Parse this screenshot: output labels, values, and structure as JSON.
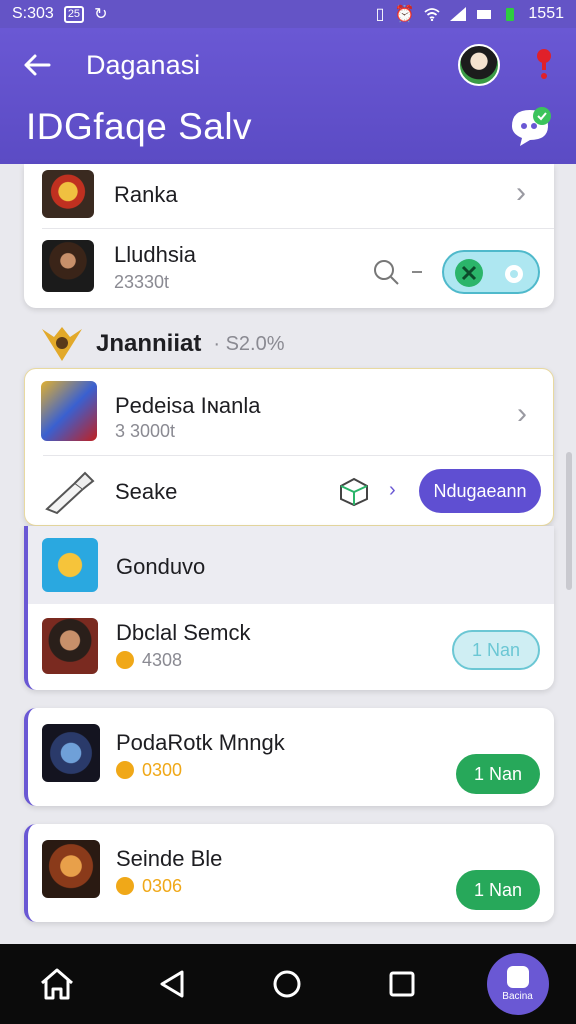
{
  "status_bar": {
    "time": "S:303",
    "box_label": "25",
    "battery_text": "1551"
  },
  "header": {
    "subtitle": "Daganasi",
    "title": "IDGfaqe Salv",
    "back_icon": "arrow-left-icon",
    "avatar_icon": "avatar",
    "pin_icon": "pin-icon",
    "chat_icon": "chat-bubble-icon"
  },
  "card1": {
    "row1": {
      "name": "Ranka"
    },
    "row2": {
      "name": "Lludhsia",
      "sub": "23330t"
    }
  },
  "section": {
    "label": "Jnanniiat",
    "percent": "· S2.0%"
  },
  "card2": {
    "row1": {
      "name": "Pedeisa Iɴanla",
      "sub": "3 3000t"
    },
    "row2": {
      "name": "Seake",
      "button": "Ndugaeann"
    }
  },
  "card3": {
    "row1": {
      "name": "Gonduvo"
    },
    "row2": {
      "name": "Dbclal Semck",
      "value": "4308",
      "button": "1 Nan"
    }
  },
  "card4": {
    "name": "PodaRotk Mnngk",
    "value": "0300",
    "button": "1 Nan"
  },
  "card5": {
    "name": "Seinde Ble",
    "value": "0306",
    "button": "1 Nan"
  },
  "navbar": {
    "fab_label": "Bacina"
  },
  "colors": {
    "accent": "#6a58d4",
    "green": "#27a85a",
    "coin": "#f0a818"
  }
}
